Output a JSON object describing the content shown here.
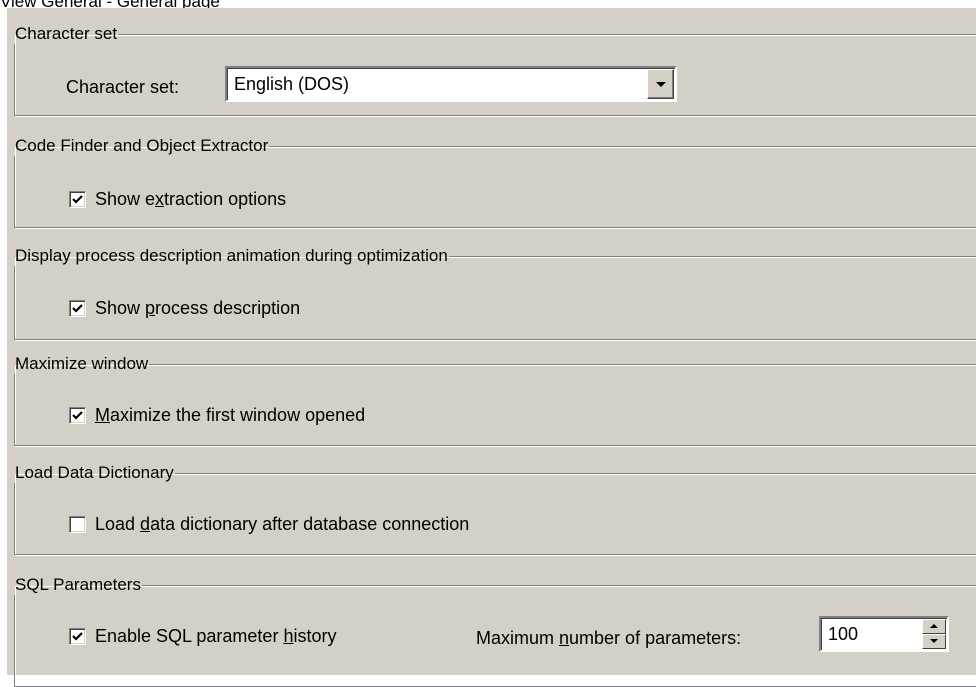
{
  "page": {
    "title": "View General - General page"
  },
  "character_set": {
    "group_label": "Character set",
    "field_label": "Character set:",
    "selected_value": "English (DOS)"
  },
  "code_finder": {
    "group_label": "Code Finder and Object Extractor",
    "checkbox": {
      "pre": "Show e",
      "mnemonic": "x",
      "post": "traction options",
      "checked": true
    }
  },
  "process_description": {
    "group_label": "Display process description animation during optimization",
    "checkbox": {
      "pre": "Show ",
      "mnemonic": "p",
      "post": "rocess description",
      "checked": true
    }
  },
  "maximize_window": {
    "group_label": "Maximize window",
    "checkbox": {
      "pre": "",
      "mnemonic": "M",
      "post": "aximize the first window opened",
      "checked": true
    }
  },
  "load_data_dictionary": {
    "group_label": "Load Data Dictionary",
    "checkbox": {
      "pre": "Load ",
      "mnemonic": "d",
      "post": "ata dictionary after database connection",
      "checked": false
    }
  },
  "sql_parameters": {
    "group_label": "SQL Parameters",
    "checkbox": {
      "pre": "Enable SQL parameter ",
      "mnemonic": "h",
      "post": "istory",
      "checked": true
    },
    "max_label": {
      "pre": "Maximum ",
      "mnemonic": "n",
      "post": "umber of parameters:"
    },
    "max_value": "100"
  },
  "colors": {
    "dialog_background": "#d4d0c8",
    "group_border": "#808080",
    "field_background": "#ffffff"
  },
  "icons": {
    "checkmark": "check-icon",
    "dropdown": "chevron-down-icon",
    "spin_up": "arrow-up-icon",
    "spin_down": "arrow-down-icon"
  }
}
